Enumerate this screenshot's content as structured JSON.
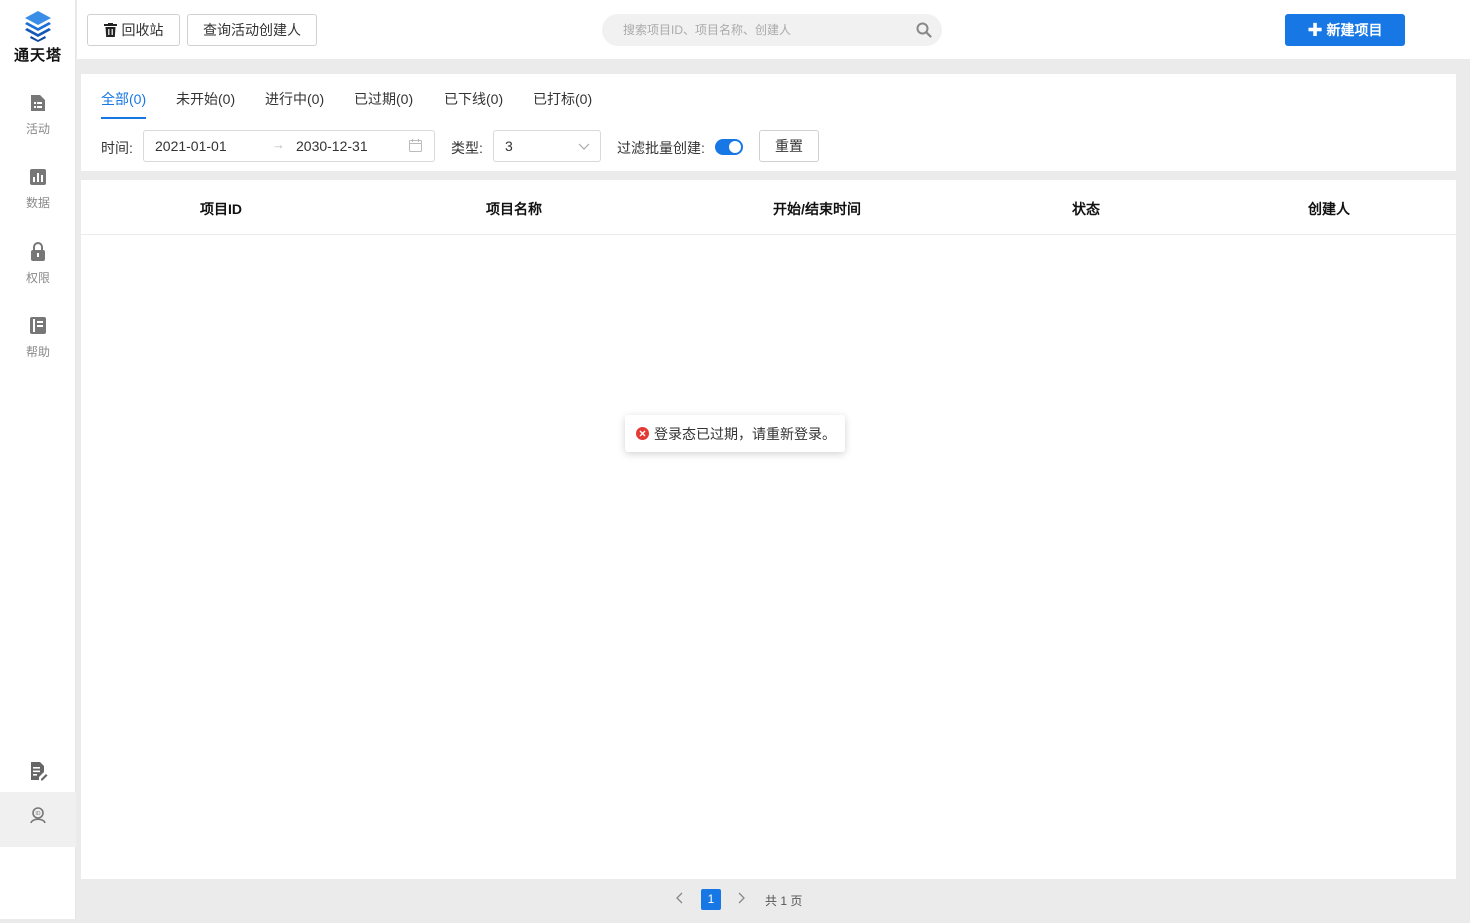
{
  "app": {
    "logo_text": "通天塔",
    "accent_color": "#1677e5"
  },
  "sidebar": {
    "items": [
      {
        "label": "活动",
        "icon": "activity-list-icon"
      },
      {
        "label": "数据",
        "icon": "bar-chart-icon"
      },
      {
        "label": "权限",
        "icon": "lock-icon"
      },
      {
        "label": "帮助",
        "icon": "book-icon"
      }
    ],
    "bottom_icons": [
      "edit-document-icon",
      "user-id-icon"
    ]
  },
  "topbar": {
    "recycle_label": "回收站",
    "query_creator_label": "查询活动创建人",
    "search_placeholder": "搜索项目ID、项目名称、创建人",
    "new_project_label": "新建项目"
  },
  "tabs": [
    {
      "label": "全部(0)",
      "active": true
    },
    {
      "label": "未开始(0)",
      "active": false
    },
    {
      "label": "进行中(0)",
      "active": false
    },
    {
      "label": "已过期(0)",
      "active": false
    },
    {
      "label": "已下线(0)",
      "active": false
    },
    {
      "label": "已打标(0)",
      "active": false
    }
  ],
  "filters": {
    "time_label": "时间:",
    "start_date": "2021-01-01",
    "date_separator": "→",
    "end_date": "2030-12-31",
    "type_label": "类型:",
    "type_value": "3",
    "filter_batch_label": "过滤批量创建:",
    "filter_batch_on": true,
    "reset_label": "重置"
  },
  "table": {
    "columns": [
      "项目ID",
      "项目名称",
      "开始/结束时间",
      "状态",
      "创建人"
    ],
    "rows": []
  },
  "toast": {
    "type": "error",
    "message": "登录态已过期，请重新登录。"
  },
  "pagination": {
    "current_page": "1",
    "total_text": "共 1 页"
  }
}
